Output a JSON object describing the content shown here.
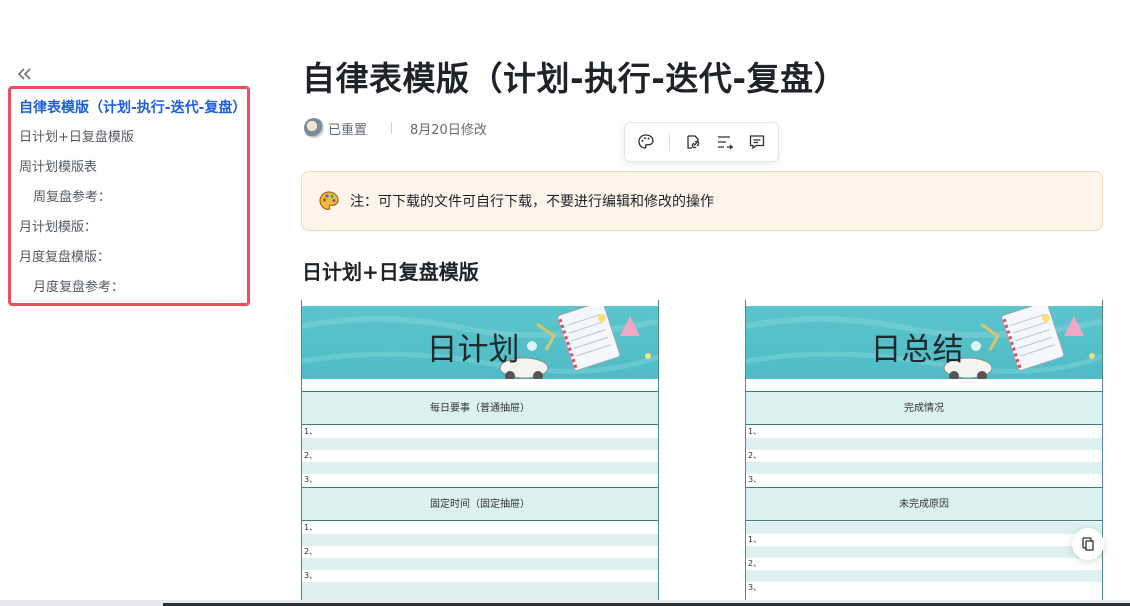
{
  "sidebar": {
    "items": [
      {
        "label": "自律表模版（计划-执行-迭代-复盘）",
        "active": true
      },
      {
        "label": "日计划+日复盘模版"
      },
      {
        "label": "周计划模版表"
      },
      {
        "label": "周复盘参考："
      },
      {
        "label": "月计划模版："
      },
      {
        "label": "月度复盘模版："
      },
      {
        "label": "月度复盘参考："
      }
    ]
  },
  "doc": {
    "title": "自律表模版（计划-执行-迭代-复盘）",
    "author": "已重置",
    "modified": "8月20日修改"
  },
  "callout": {
    "icon": "palette-icon",
    "text": "注：可下载的文件可自行下载，不要进行编辑和修改的操作"
  },
  "section": {
    "heading": "日计划+日复盘模版"
  },
  "images": {
    "left": {
      "banner": "日计划",
      "head1": "每日要事（普通抽屉）",
      "rows1": [
        "1、",
        "2、",
        "3、"
      ],
      "head2": "固定时间（固定抽屉）",
      "rows2": [
        "1、",
        "2、",
        "3、"
      ]
    },
    "right": {
      "banner": "日总结",
      "head1": "完成情况",
      "rows1": [
        "1、",
        "2、",
        "3、"
      ],
      "head2": "未完成原因",
      "rows2": [
        "1、",
        "2、",
        "3、"
      ]
    }
  },
  "colors": {
    "accent": "#1d5ee6",
    "highlight_border": "#ee4f5f",
    "callout_bg": "#fef4ea",
    "banner_teal": "#55c1c9"
  }
}
